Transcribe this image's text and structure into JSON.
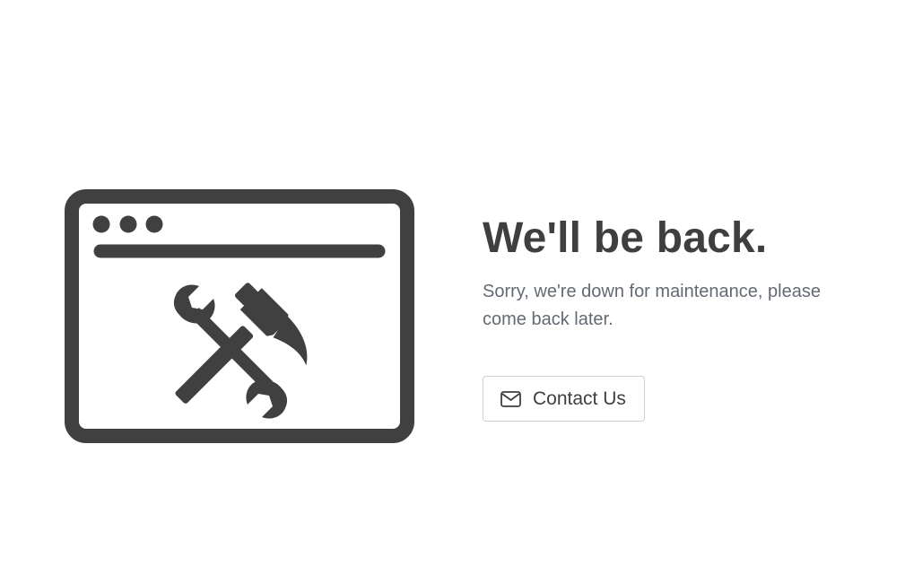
{
  "illustration": {
    "name": "browser-window-with-tools",
    "icons": [
      "window-frame-icon",
      "window-dots-icon",
      "address-bar-icon",
      "wrench-icon",
      "hammer-icon"
    ],
    "color": "#404040"
  },
  "main": {
    "headline": "We'll be back.",
    "message": "Sorry, we're down for maintenance, please come back later."
  },
  "contact_button": {
    "label": "Contact Us",
    "icon": "envelope-icon"
  },
  "colors": {
    "background": "#ffffff",
    "headline": "#3f3f3f",
    "message": "#636a73",
    "button_border": "#cfcfcf"
  }
}
